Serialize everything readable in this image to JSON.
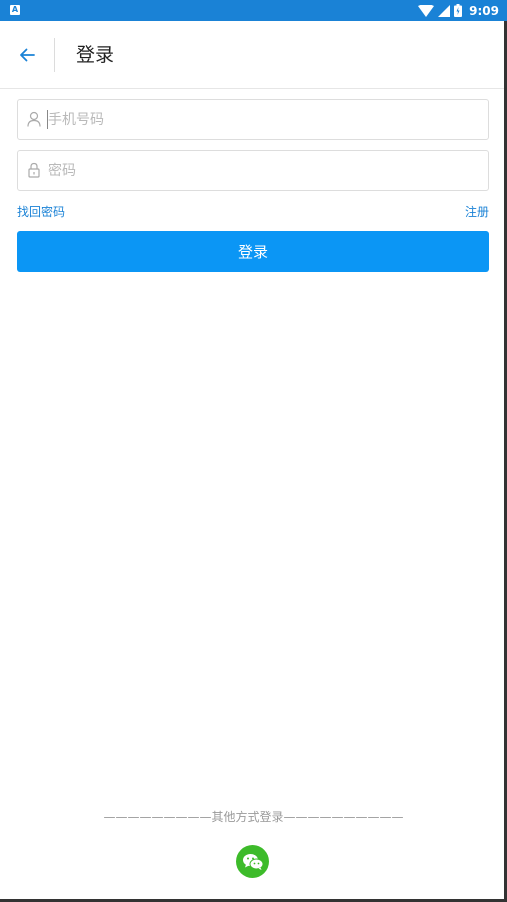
{
  "status_bar": {
    "time": "9:09",
    "left_icon_letter": "A",
    "icons": [
      "wifi-icon",
      "cell-signal-icon",
      "battery-icon"
    ],
    "color": "#1a82d6"
  },
  "app_bar": {
    "title": "登录",
    "back_icon": "arrow-left-icon"
  },
  "form": {
    "phone": {
      "placeholder": "手机号码",
      "value": "",
      "icon": "user-icon"
    },
    "password": {
      "placeholder": "密码",
      "value": "",
      "icon": "lock-icon"
    },
    "forgot_label": "找回密码",
    "register_label": "注册",
    "login_label": "登录",
    "accent": "#0b96f5"
  },
  "alt_login": {
    "label": "其他方式登录",
    "left_dashes": "—————————",
    "right_dashes": "——————————",
    "icon": "wechat-icon",
    "icon_color": "#3dbb2a"
  }
}
